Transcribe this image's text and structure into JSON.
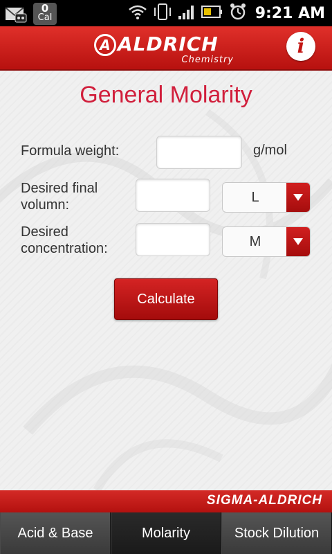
{
  "status_bar": {
    "calendar_count": "0",
    "calendar_label": "Cal",
    "time": "9:21 AM"
  },
  "header": {
    "logo_text": "ALDRICH",
    "logo_sub": "Chemistry",
    "info_label": "i"
  },
  "main": {
    "title": "General Molarity",
    "formula_weight": {
      "label": "Formula weight:",
      "value": "",
      "unit": "g/mol"
    },
    "final_volume": {
      "label_line1": "Desired final",
      "label_line2": "volumn:",
      "value": "",
      "unit_selected": "L"
    },
    "concentration": {
      "label_line1": "Desired",
      "label_line2": "concentration:",
      "value": "",
      "unit_selected": "M"
    },
    "calculate_label": "Calculate"
  },
  "footer": {
    "brand": "SIGMA-ALDRICH"
  },
  "tabs": [
    {
      "label": "Acid & Base",
      "active": false
    },
    {
      "label": "Molarity",
      "active": true
    },
    {
      "label": "Stock Dilution",
      "active": false
    }
  ],
  "colors": {
    "brand_red": "#c21512",
    "title_red": "#d11f3c"
  }
}
